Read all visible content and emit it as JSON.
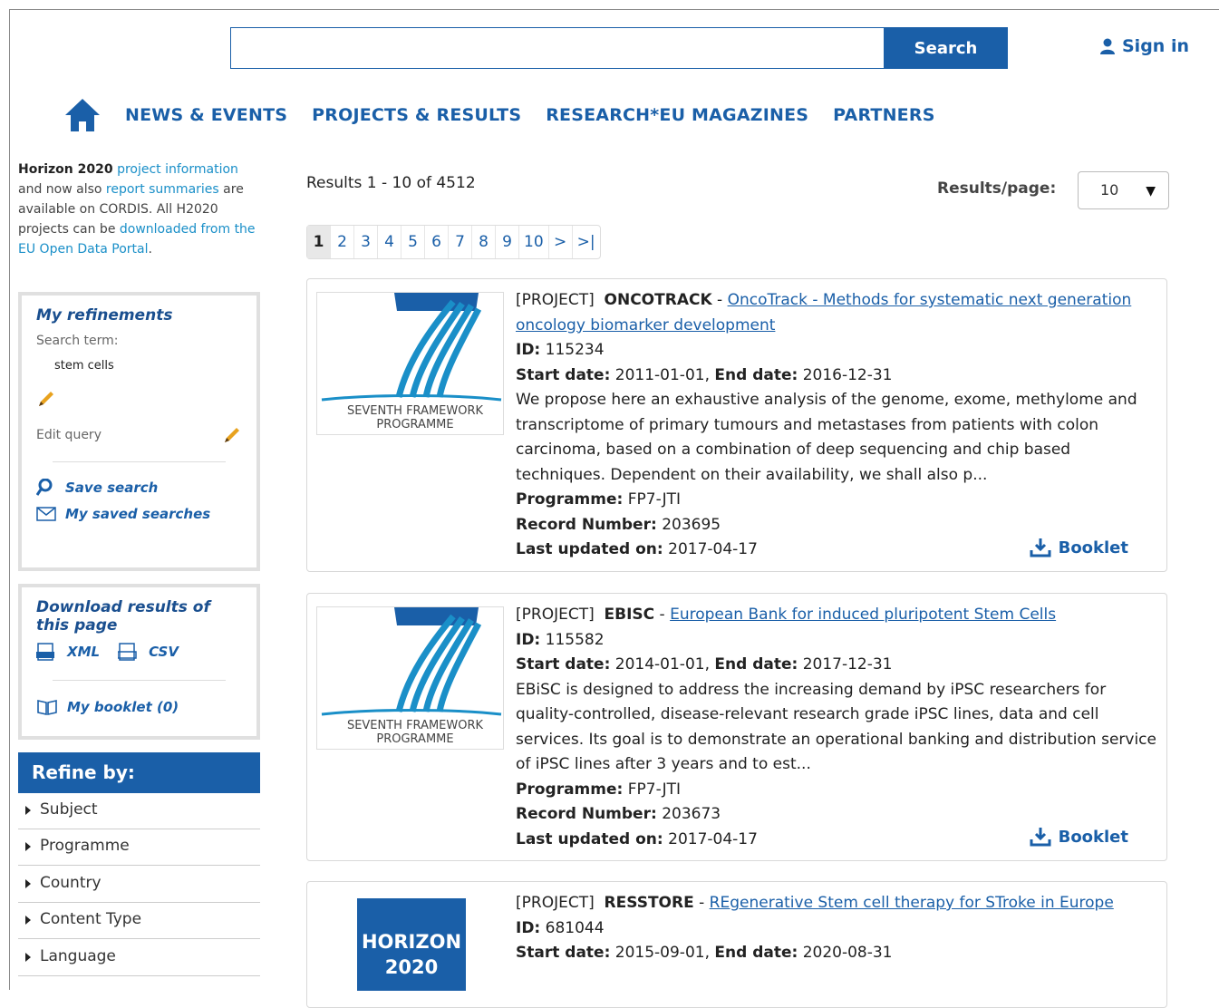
{
  "header": {
    "search_placeholder": "",
    "search_button": "Search",
    "signin": "Sign in"
  },
  "nav": {
    "items": [
      "NEWS & EVENTS",
      "PROJECTS & RESULTS",
      "RESEARCH*EU MAGAZINES",
      "PARTNERS"
    ]
  },
  "intro": {
    "strong": "Horizon 2020",
    "link1": "project information",
    "text1": "and now also",
    "link2": "report summaries",
    "text2": "are available on CORDIS. All H2020 projects can be",
    "link3": "downloaded from the EU Open Data Portal",
    "text3": "."
  },
  "refinements": {
    "title": "My refinements",
    "search_term_label": "Search term:",
    "search_term": "stem cells",
    "edit_query": "Edit query",
    "save_search": "Save search",
    "saved_searches": "My saved searches"
  },
  "download": {
    "title": "Download results of this page",
    "xml": "XML",
    "csv": "CSV",
    "booklet": "My booklet (0)"
  },
  "refine": {
    "header": "Refine by:",
    "items": [
      "Subject",
      "Programme",
      "Country",
      "Content Type",
      "Language"
    ]
  },
  "results": {
    "count": "Results 1 - 10 of 4512",
    "per_page_label": "Results/page:",
    "per_page_value": "10",
    "pages": [
      "1",
      "2",
      "3",
      "4",
      "5",
      "6",
      "7",
      "8",
      "9",
      "10",
      ">",
      ">|"
    ]
  },
  "labels": {
    "id": "ID:",
    "start": "Start date:",
    "end": "End date:",
    "programme": "Programme:",
    "record": "Record Number:",
    "updated": "Last updated on:",
    "booklet": "Booklet"
  },
  "items": [
    {
      "type": "[PROJECT]",
      "acronym": "ONCOTRACK",
      "title": "OncoTrack - Methods for systematic next generation oncology biomarker development",
      "id": "115234",
      "start": "2011-01-01",
      "end": "2016-12-31",
      "description": "We propose here an exhaustive analysis of the genome, exome, methylome and transcriptome of primary tumours and metastases from patients with colon carcinoma, based on a combination of deep sequencing and chip based techniques. Dependent on their availability, we shall also p...",
      "programme": "FP7-JTI",
      "record": "203695",
      "updated": "2017-04-17",
      "logo_line1": "SEVENTH FRAMEWORK",
      "logo_line2": "PROGRAMME"
    },
    {
      "type": "[PROJECT]",
      "acronym": "EBISC",
      "title": "European Bank for induced pluripotent Stem Cells",
      "id": "115582",
      "start": "2014-01-01",
      "end": "2017-12-31",
      "description": "EBiSC is designed to address the increasing demand by iPSC researchers for quality-controlled, disease-relevant research grade iPSC lines, data and cell services. Its goal is to demonstrate an operational banking and distribution service of iPSC lines after 3 years and to est...",
      "programme": "FP7-JTI",
      "record": "203673",
      "updated": "2017-04-17",
      "logo_line1": "SEVENTH FRAMEWORK",
      "logo_line2": "PROGRAMME"
    },
    {
      "type": "[PROJECT]",
      "acronym": "RESSTORE",
      "title": "REgenerative Stem cell therapy for STroke in Europe",
      "id": "681044",
      "start": "2015-09-01",
      "end": "2020-08-31",
      "logo_line1": "HORIZON",
      "logo_line2": "2020"
    }
  ],
  "colors": {
    "primary": "#1a5fa8",
    "link_light": "#1a8fc8"
  }
}
